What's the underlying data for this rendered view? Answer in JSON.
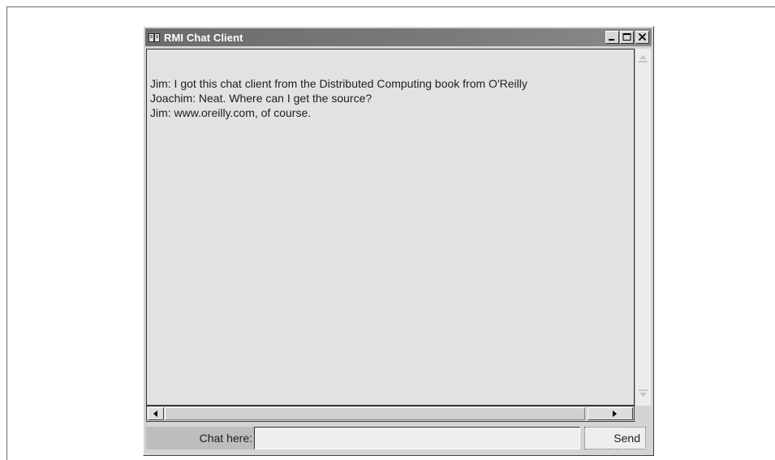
{
  "window": {
    "title": "RMI Chat Client",
    "icon": "book-icon",
    "controls": [
      "minimize-icon",
      "maximize-icon",
      "close-icon"
    ]
  },
  "chat": {
    "lines": [
      "Jim: I got this chat client from the Distributed Computing book from O'Reilly",
      "Joachim: Neat.  Where can I get the source?",
      "Jim: www.oreilly.com, of course."
    ]
  },
  "input": {
    "label": "Chat here:",
    "value": ""
  },
  "send_label": "Send"
}
